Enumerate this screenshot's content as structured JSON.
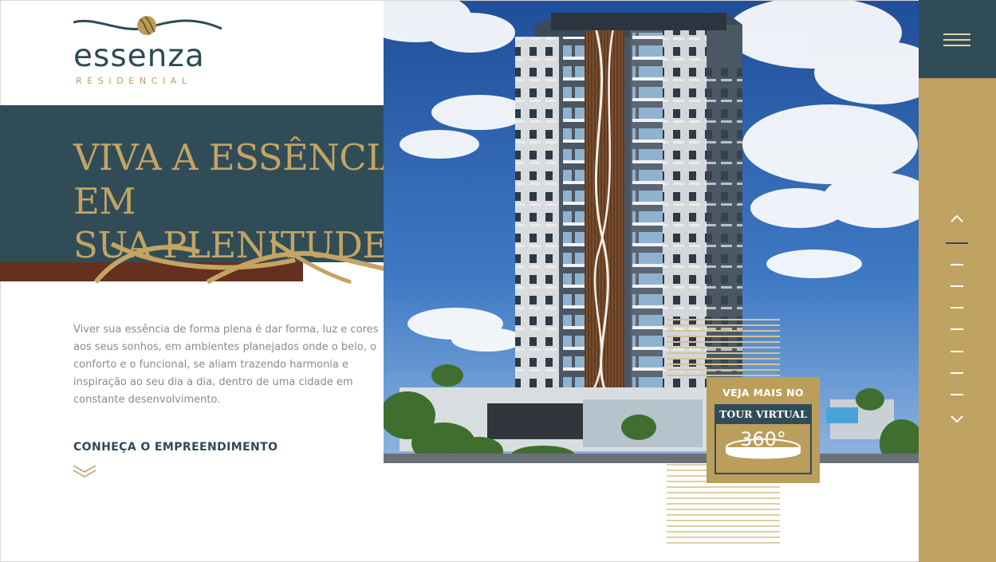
{
  "logo": {
    "name": "essenza",
    "subtitle": "RESIDENCIAL"
  },
  "hero": {
    "headline_line1": "VIVA A ESSÊNCIA EM",
    "headline_line2": "SUA PLENITUDE!",
    "intro": "Viver sua essência de forma plena é dar forma, luz e cores aos seus sonhos, em ambientes planejados onde o belo, o conforto e o funcional, se aliam trazendo harmonia e inspiração ao seu dia a dia, dentro de uma cidade em constante desenvolvimento.",
    "cta_label": "CONHEÇA O EMPREENDIMENTO"
  },
  "tour": {
    "top_label": "VEJA MAIS NO",
    "band_label": "TOUR VIRTUAL",
    "degrees": "360°"
  },
  "rail": {
    "slide_count": 8,
    "active_slide": 1
  },
  "icons": {
    "menu": "hamburger-icon",
    "up": "chevron-up-icon",
    "down": "chevron-down-icon",
    "scroll": "double-chevron-down-icon"
  },
  "colors": {
    "teal": "#304d57",
    "gold": "#c0a262",
    "brown": "#65301e",
    "text_gray": "#8a8a8a"
  }
}
